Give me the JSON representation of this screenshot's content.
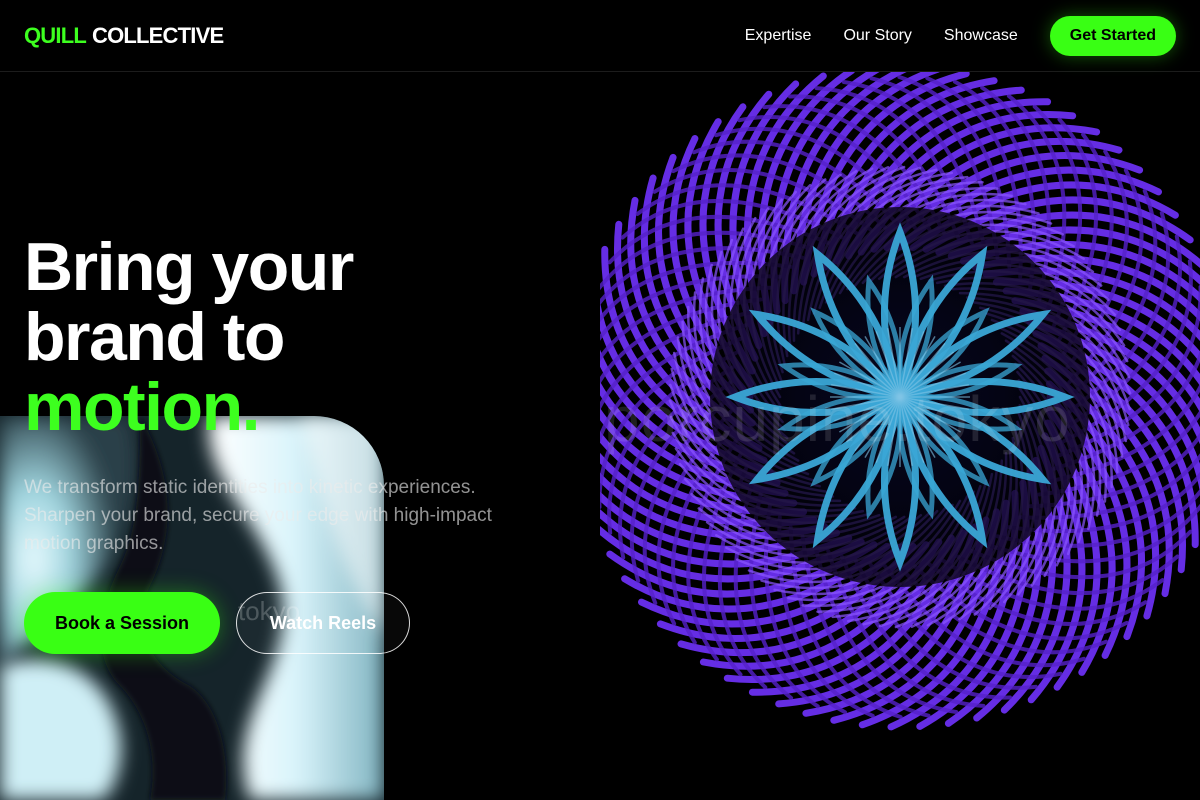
{
  "header": {
    "logo": {
      "part1": "QUILL",
      "part2": "COLLECTIVE"
    },
    "nav": [
      {
        "label": "Expertise"
      },
      {
        "label": "Our Story"
      },
      {
        "label": "Showcase"
      }
    ],
    "cta_label": "Get Started"
  },
  "hero": {
    "headline": {
      "line1": "Bring your",
      "line2": "brand to",
      "line3": "motion",
      "dot": "."
    },
    "description": "We transform static identities into kinetic experiences. Sharpen your brand, secure your edge with high-impact motion graphics.",
    "primary_button": "Book a Session",
    "secondary_button": "Watch Reels"
  },
  "artwork": {
    "watermark": "porcupine.tokyo",
    "watermark_small": "tokyo"
  },
  "colors": {
    "accent": "#39ff14",
    "background": "#000000",
    "art_purple": "#6a2ff0",
    "art_cyan": "#3aa7d6"
  },
  "icons": [
    "spiral-art",
    "flower-art"
  ]
}
